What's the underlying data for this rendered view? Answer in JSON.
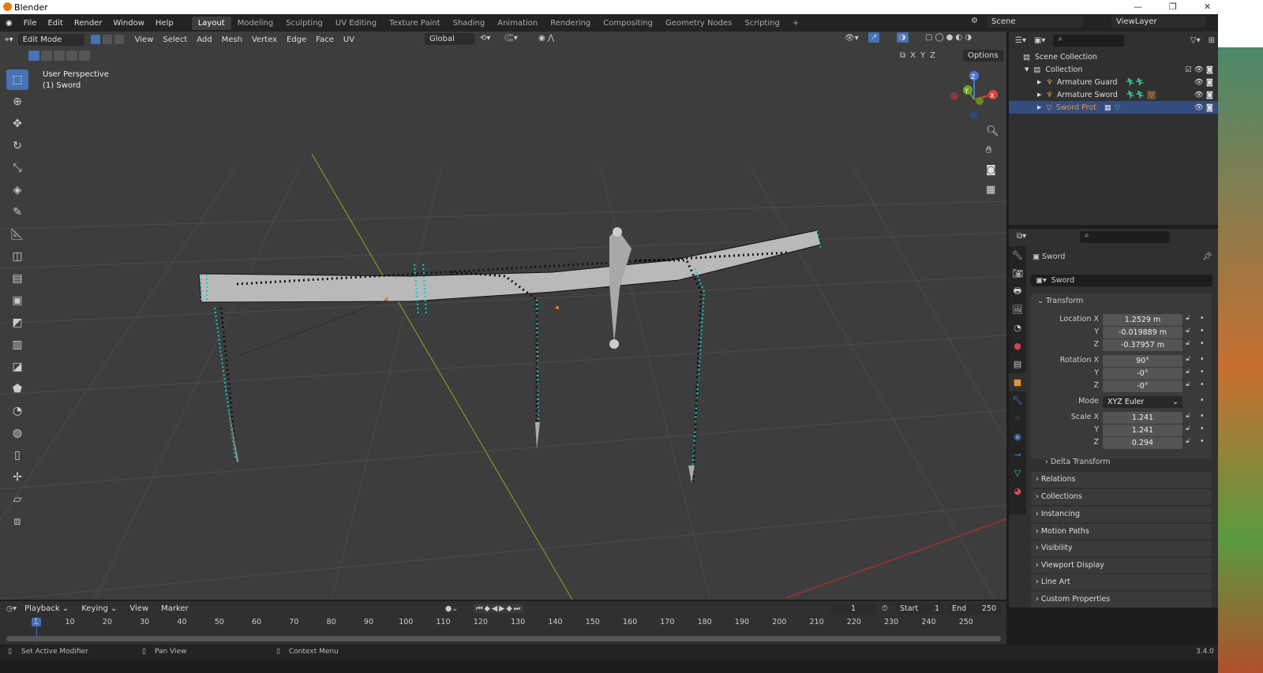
{
  "window": {
    "title": "Blender",
    "version": "3.4.0"
  },
  "menu": [
    "File",
    "Edit",
    "Render",
    "Window",
    "Help"
  ],
  "workspaces": [
    "Layout",
    "Modeling",
    "Sculpting",
    "UV Editing",
    "Texture Paint",
    "Shading",
    "Animation",
    "Rendering",
    "Compositing",
    "Geometry Nodes",
    "Scripting"
  ],
  "active_workspace": "Layout",
  "scene": {
    "name": "Scene",
    "view_layer": "ViewLayer"
  },
  "viewport": {
    "mode": "Edit Mode",
    "menus": [
      "View",
      "Select",
      "Add",
      "Mesh",
      "Vertex",
      "Edge",
      "Face",
      "UV"
    ],
    "orientation": "Global",
    "options_label": "Options",
    "axes_labels": [
      "X",
      "Y",
      "Z"
    ],
    "perspective": "User Perspective",
    "object_label": "(1) Sword",
    "gizmo": {
      "x": "X",
      "y": "Y",
      "z": "Z"
    }
  },
  "outliner": {
    "root": "Scene Collection",
    "collection": "Collection",
    "items": [
      {
        "name": "Armature Guard",
        "color": "#dddddd"
      },
      {
        "name": "Armature Sword",
        "color": "#dddddd"
      },
      {
        "name": "Sword Prot",
        "color": "#e8923a"
      }
    ]
  },
  "properties": {
    "object_name": "Sword",
    "data_name": "Sword",
    "transform_label": "Transform",
    "location": {
      "label": "Location X",
      "x": "1.2529 m",
      "y": "-0.019889 m",
      "z": "-0.37957 m"
    },
    "rotation": {
      "label": "Rotation X",
      "x": "90°",
      "y": "-0°",
      "z": "-0°"
    },
    "mode": {
      "label": "Mode",
      "value": "XYZ Euler"
    },
    "scale": {
      "label": "Scale X",
      "x": "1.241",
      "y": "1.241",
      "z": "0.294"
    },
    "axis_y": "Y",
    "axis_z": "Z",
    "panels": [
      "Delta Transform",
      "Relations",
      "Collections",
      "Instancing",
      "Motion Paths",
      "Visibility",
      "Viewport Display",
      "Line Art",
      "Custom Properties"
    ]
  },
  "timeline": {
    "menus": [
      "Playback",
      "Keying",
      "View",
      "Marker"
    ],
    "current_frame": "1",
    "start_label": "Start",
    "start": "1",
    "end_label": "End",
    "end": "250",
    "ticks": [
      "1",
      "10",
      "20",
      "30",
      "40",
      "50",
      "60",
      "70",
      "80",
      "90",
      "100",
      "110",
      "120",
      "130",
      "140",
      "150",
      "160",
      "170",
      "180",
      "190",
      "200",
      "210",
      "220",
      "230",
      "240",
      "250"
    ]
  },
  "status": {
    "left": "Set Active Modifier",
    "middle": "Pan View",
    "right": "Context Menu"
  }
}
